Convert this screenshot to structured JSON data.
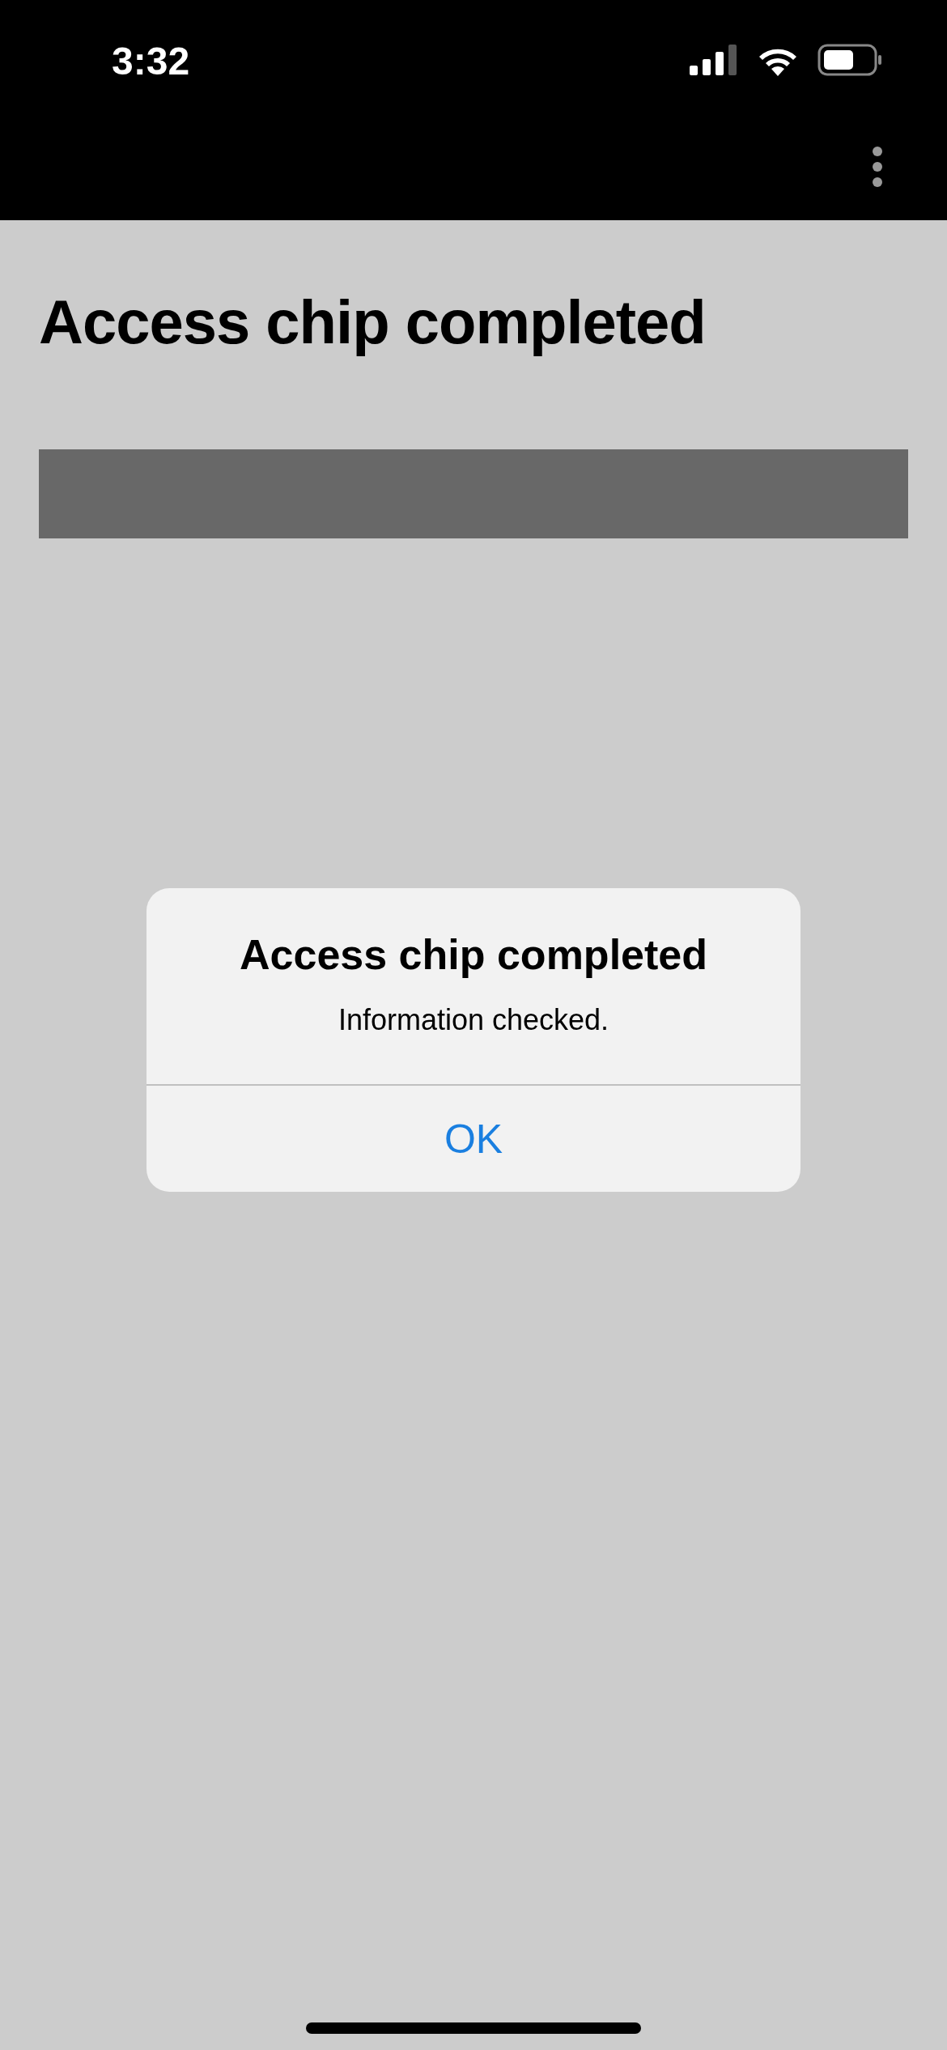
{
  "status_bar": {
    "time": "3:32"
  },
  "page": {
    "title": "Access chip completed"
  },
  "alert": {
    "title": "Access chip completed",
    "message": "Information checked.",
    "buttons": [
      "OK"
    ]
  }
}
